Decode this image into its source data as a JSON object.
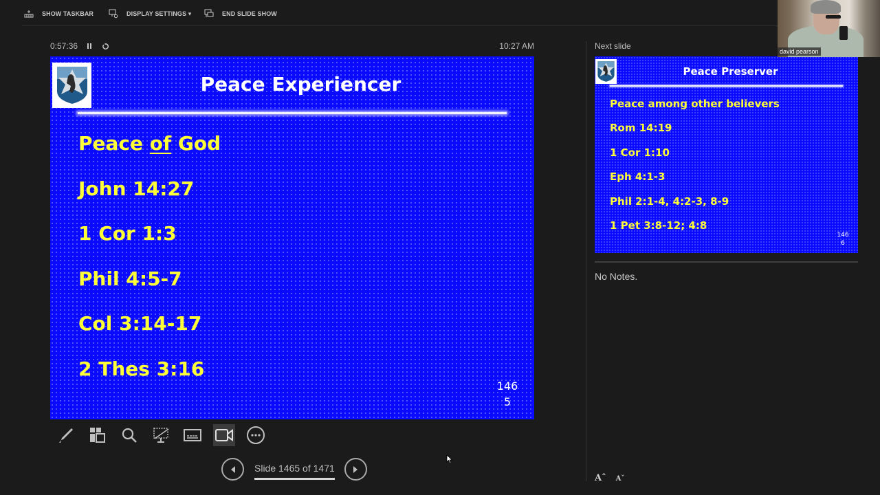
{
  "toolbar": {
    "show_taskbar": "SHOW TASKBAR",
    "display_settings": "DISPLAY SETTINGS ▾",
    "end_slide_show": "END SLIDE SHOW"
  },
  "presenter": {
    "elapsed_time": "0:57:36",
    "clock": "10:27 AM",
    "slide_counter": "Slide 1465 of 1471",
    "next_slide_label": "Next slide",
    "notes": "No Notes.",
    "font_increase": "Aˆ",
    "font_decrease": "Aˇ",
    "webcam_name": "david pearson"
  },
  "current_slide": {
    "title": "Peace Experiencer",
    "bullets": [
      {
        "pre": "Peace ",
        "underlined": "of",
        "post": " God"
      },
      {
        "text": "John 14:27"
      },
      {
        "text": "1 Cor 1:3"
      },
      {
        "text": "Phil 4:5-7"
      },
      {
        "text": "Col 3:14-17"
      },
      {
        "text": "2 Thes 3:16"
      }
    ],
    "number_line1": "146",
    "number_line2": "5"
  },
  "next_slide": {
    "title": "Peace Preserver",
    "bullets": [
      "Peace among other believers",
      "Rom 14:19",
      "1 Cor 1:10",
      "Eph 4:1-3",
      "Phil 2:1-4, 4:2-3, 8-9",
      "1 Pet 3:8-12; 4:8"
    ],
    "number_line1": "146",
    "number_line2": "6"
  },
  "tools": [
    "pen-tool",
    "see-all-slides",
    "zoom-into-slide",
    "black-screen",
    "subtitles",
    "camera",
    "more-options"
  ],
  "colors": {
    "slide_bg": "#0a0aff",
    "slide_text": "#ffff38",
    "title_text": "#ffffff",
    "app_bg": "#1b1b1b"
  }
}
